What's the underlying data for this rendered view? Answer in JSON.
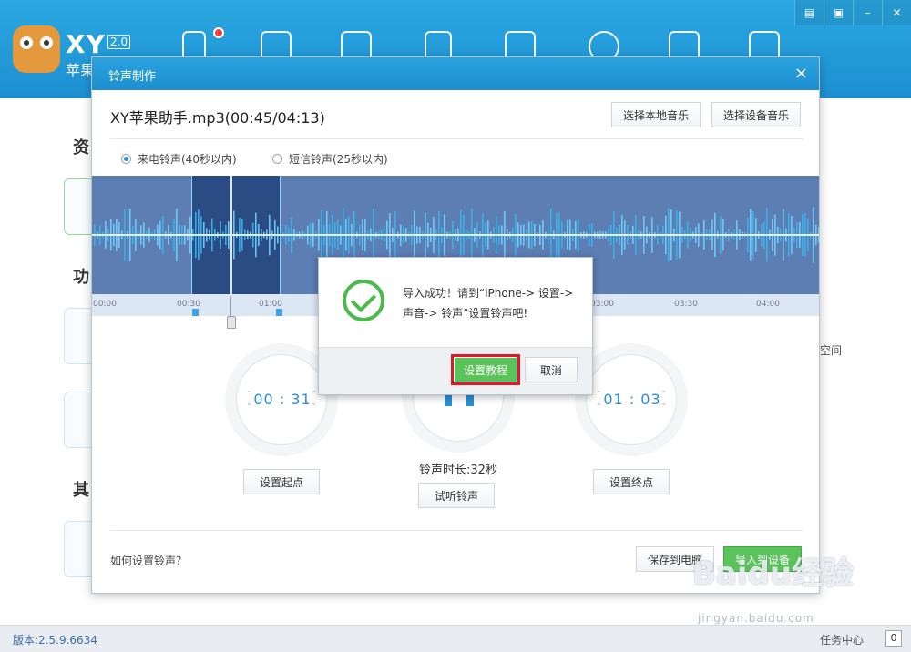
{
  "app": {
    "brand": "XY",
    "version_badge": "2.0",
    "subtitle": "苹果",
    "nav_icons": [
      "phone-icon",
      "apps-icon",
      "game-controller-icon",
      "ebook-icon",
      "wallpaper-icon",
      "plus-circle-icon",
      "shopping-bag-icon",
      "logout-arrow-icon"
    ],
    "window_buttons": [
      "menu-icon",
      "skin-icon",
      "minimize-icon",
      "close-icon"
    ]
  },
  "background": {
    "section_labels": [
      "资",
      "功",
      "其"
    ],
    "right_text": "空间"
  },
  "status": {
    "version": "版本:2.5.9.6634",
    "task_center": "任务中心",
    "task_count": "0"
  },
  "dialog": {
    "title": "铃声制作",
    "close": "×",
    "file_title": "XY苹果助手.mp3(00:45/04:13)",
    "btn_local": "选择本地音乐",
    "btn_device": "选择设备音乐",
    "radio_call": "来电铃声(40秒以内)",
    "radio_sms": "短信铃声(25秒以内)",
    "radio_selected": "call",
    "timeline_ticks": [
      "00:00",
      "00:30",
      "01:00",
      "03:00",
      "03:30",
      "04:00"
    ],
    "start_time": "00 : 31",
    "end_time": "01 : 03",
    "btn_set_start": "设置起点",
    "btn_set_end": "设置终点",
    "ring_length": "铃声时长:32秒",
    "btn_preview": "试听铃声",
    "help_link": "如何设置铃声？",
    "btn_save_pc": "保存到电脑",
    "btn_import": "导入到设备"
  },
  "popup": {
    "message": "导入成功！请到“iPhone-> 设置-> 声音-> 铃声“设置铃声吧!",
    "btn_tutorial": "设置教程",
    "btn_cancel": "取消"
  },
  "watermark": {
    "text": "Baidu经验",
    "sub": "jingyan.baidu.com"
  },
  "colors": {
    "accent": "#1d8fd0",
    "wave": "#5c7eb3",
    "selection": "#2a4b83",
    "success": "#4cb94c",
    "highlight": "#e3162a"
  }
}
